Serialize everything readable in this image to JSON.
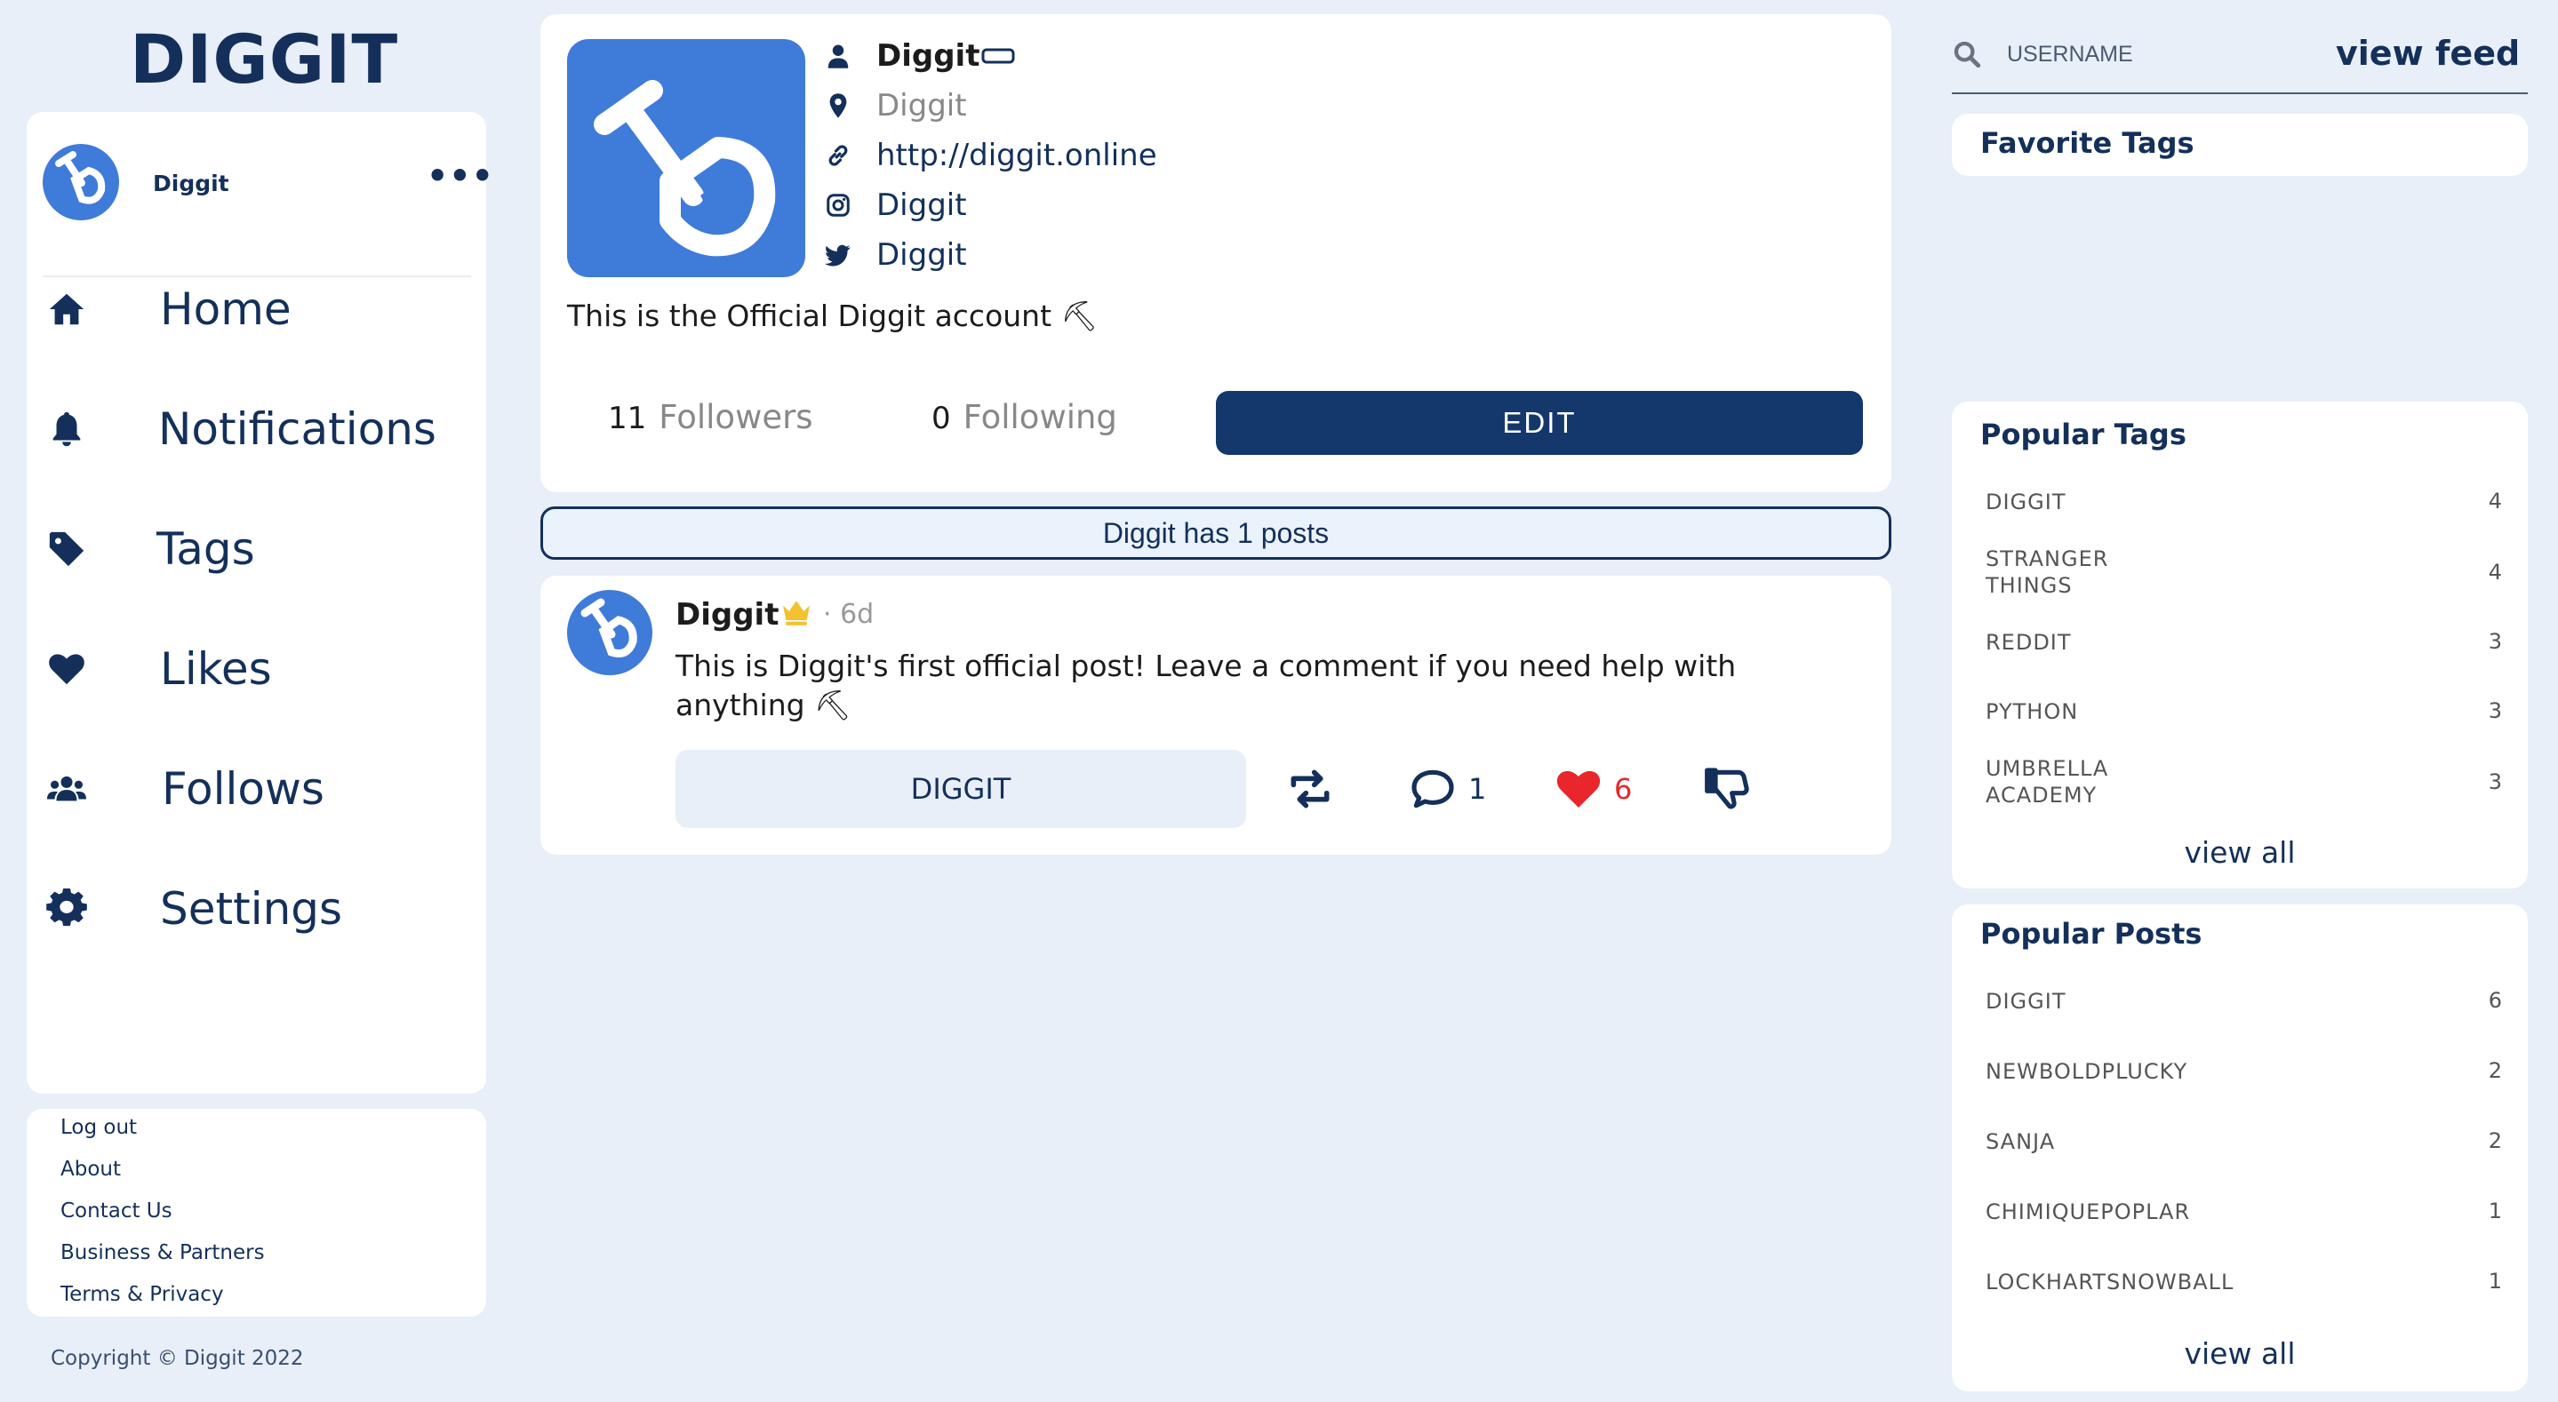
{
  "app": {
    "logo": "DIGGIT"
  },
  "account": {
    "name": "Diggit",
    "more": "•••"
  },
  "nav": {
    "items": [
      {
        "label": "Home",
        "icon": "home-icon"
      },
      {
        "label": "Notifications",
        "icon": "bell-icon"
      },
      {
        "label": "Tags",
        "icon": "tag-icon"
      },
      {
        "label": "Likes",
        "icon": "heart-icon"
      },
      {
        "label": "Follows",
        "icon": "users-icon"
      },
      {
        "label": "Settings",
        "icon": "gear-icon"
      }
    ]
  },
  "footer": {
    "links": [
      "Log out",
      "About",
      "Contact Us",
      "Business & Partners",
      "Terms & Privacy"
    ],
    "copyright": "Copyright © Diggit 2022"
  },
  "profile": {
    "name": "Diggit",
    "location": "Diggit",
    "website": "http://diggit.online",
    "instagram": "Diggit",
    "twitter": "Diggit",
    "bio": "This is the Official Diggit account ⛏",
    "followers_count": "11",
    "followers_label": "Followers",
    "following_count": "0",
    "following_label": "Following",
    "edit_label": "EDIT"
  },
  "posts_summary": "Diggit has 1 posts",
  "post": {
    "author": "Diggit",
    "age": "· 6d",
    "body": "This is Diggit's first official post! Leave a comment if you need help with anything ⛏",
    "tag": "DIGGIT",
    "comments": "1",
    "likes": "6"
  },
  "search": {
    "placeholder": "USERNAME",
    "view_feed": "view feed"
  },
  "favorite_tags": {
    "title": "Favorite Tags"
  },
  "popular_tags": {
    "title": "Popular Tags",
    "items": [
      {
        "name": "DIGGIT",
        "count": "4"
      },
      {
        "name": "STRANGER THINGS",
        "count": "4"
      },
      {
        "name": "REDDIT",
        "count": "3"
      },
      {
        "name": "PYTHON",
        "count": "3"
      },
      {
        "name": "UMBRELLA ACADEMY",
        "count": "3"
      }
    ],
    "view_all": "view all"
  },
  "popular_posts": {
    "title": "Popular Posts",
    "items": [
      {
        "name": "DIGGIT",
        "count": "6"
      },
      {
        "name": "NEWBOLDPLUCKY",
        "count": "2"
      },
      {
        "name": "SANJA",
        "count": "2"
      },
      {
        "name": "CHIMIQUEPOPLAR",
        "count": "1"
      },
      {
        "name": "LOCKHARTSNOWBALL",
        "count": "1"
      }
    ],
    "view_all": "view all"
  },
  "colors": {
    "background": "#e8eff8",
    "navy": "#14305a",
    "button": "#14386c",
    "brand_blue": "#3f7bd9",
    "like_red": "#e8262b",
    "crown_gold": "#f2c230"
  }
}
